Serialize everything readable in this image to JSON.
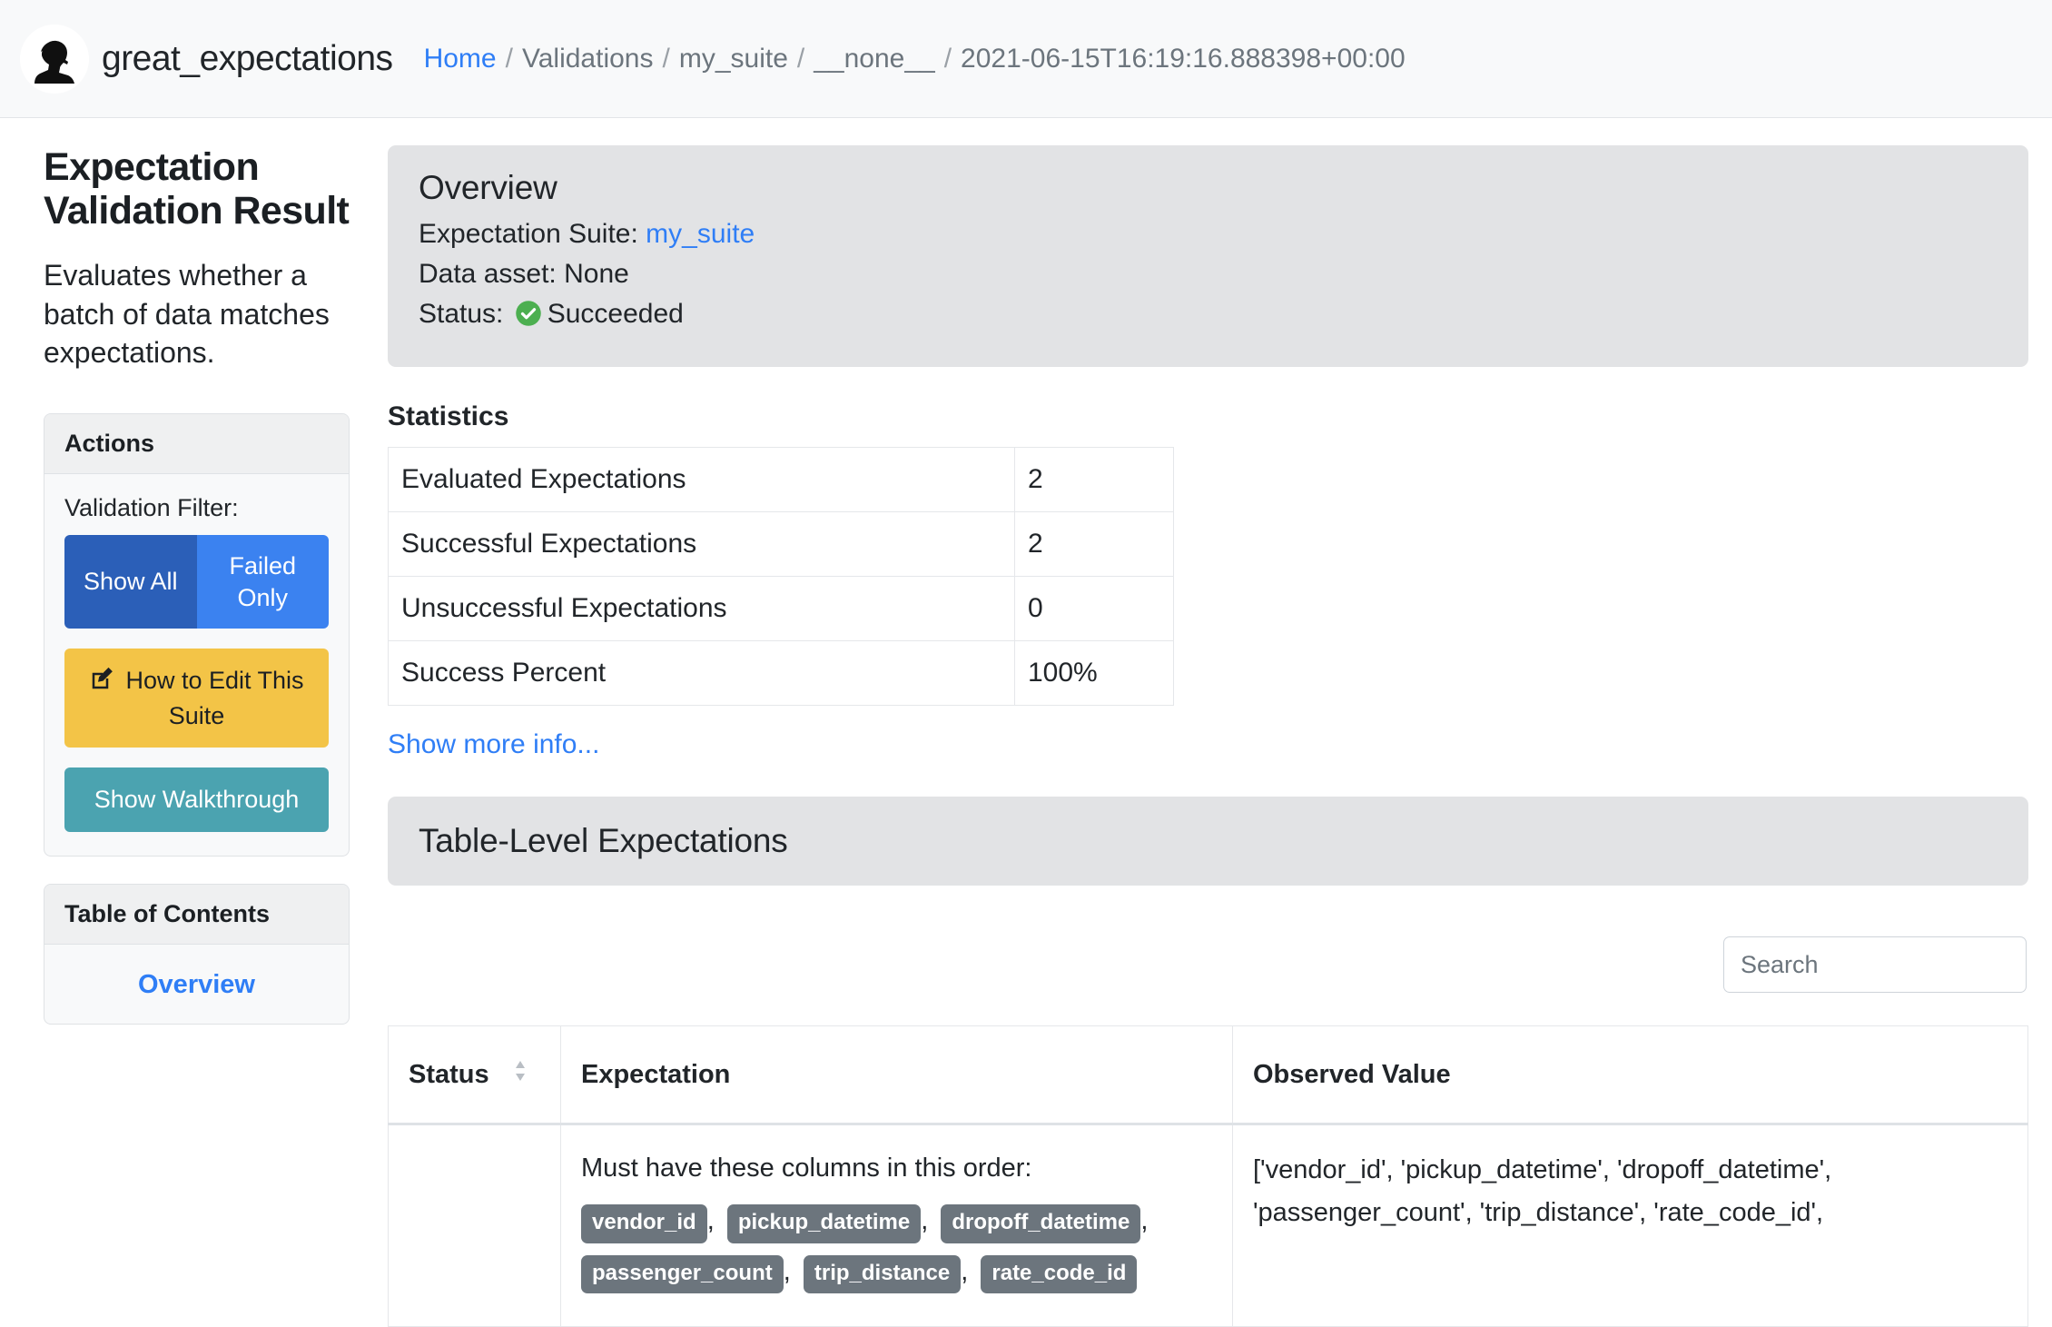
{
  "navbar": {
    "logo_icon": "great-expectations-logo-icon",
    "brand": "great_expectations",
    "breadcrumb": {
      "home": "Home",
      "separator": "/",
      "items": [
        "Validations",
        "my_suite",
        "__none__",
        "2021-06-15T16:19:16.888398+00:00"
      ]
    }
  },
  "sidebar": {
    "title": "Expectation Validation Result",
    "description": "Evaluates whether a batch of data matches expectations.",
    "actions_card": {
      "header": "Actions",
      "filter_label": "Validation Filter:",
      "show_all_label": "Show All",
      "failed_only_label": "Failed Only",
      "edit_suite_label": "How to Edit This Suite",
      "edit_icon": "edit-pencil-square-icon",
      "walkthrough_label": "Show Walkthrough"
    },
    "toc_card": {
      "header": "Table of Contents",
      "items": [
        "Overview"
      ]
    }
  },
  "main": {
    "overview": {
      "title": "Overview",
      "suite_label": "Expectation Suite:",
      "suite_value": "my_suite",
      "asset_label": "Data asset:",
      "asset_value": "None",
      "status_label": "Status:",
      "status_icon": "check-circle-icon",
      "status_value": "Succeeded"
    },
    "statistics": {
      "title": "Statistics",
      "rows": [
        {
          "key": "Evaluated Expectations",
          "value": "2"
        },
        {
          "key": "Successful Expectations",
          "value": "2"
        },
        {
          "key": "Unsuccessful Expectations",
          "value": "0"
        },
        {
          "key": "Success Percent",
          "value": "100%"
        }
      ],
      "show_more_label": "Show more info..."
    },
    "table_level": {
      "heading": "Table-Level Expectations",
      "search_placeholder": "Search",
      "search_value": "",
      "columns": {
        "status": "Status",
        "status_sort_icon": "sort-updown-icon",
        "expectation": "Expectation",
        "observed": "Observed Value"
      },
      "rows": [
        {
          "status": "",
          "expectation_text": "Must have these columns in this order:",
          "expectation_columns": [
            "vendor_id",
            "pickup_datetime",
            "dropoff_datetime",
            "passenger_count",
            "trip_distance",
            "rate_code_id"
          ],
          "observed_value": "['vendor_id', 'pickup_datetime', 'dropoff_datetime', 'passenger_count', 'trip_distance', 'rate_code_id',"
        }
      ]
    }
  },
  "colors": {
    "link": "#2f7ef6",
    "show_all": "#2b5fb8",
    "failed_only": "#3b82f0",
    "edit_suite": "#f3c447",
    "walkthrough": "#4ba3b0",
    "panel_bg": "#e2e3e5",
    "success": "#4caf50",
    "pill": "#6c757d"
  }
}
